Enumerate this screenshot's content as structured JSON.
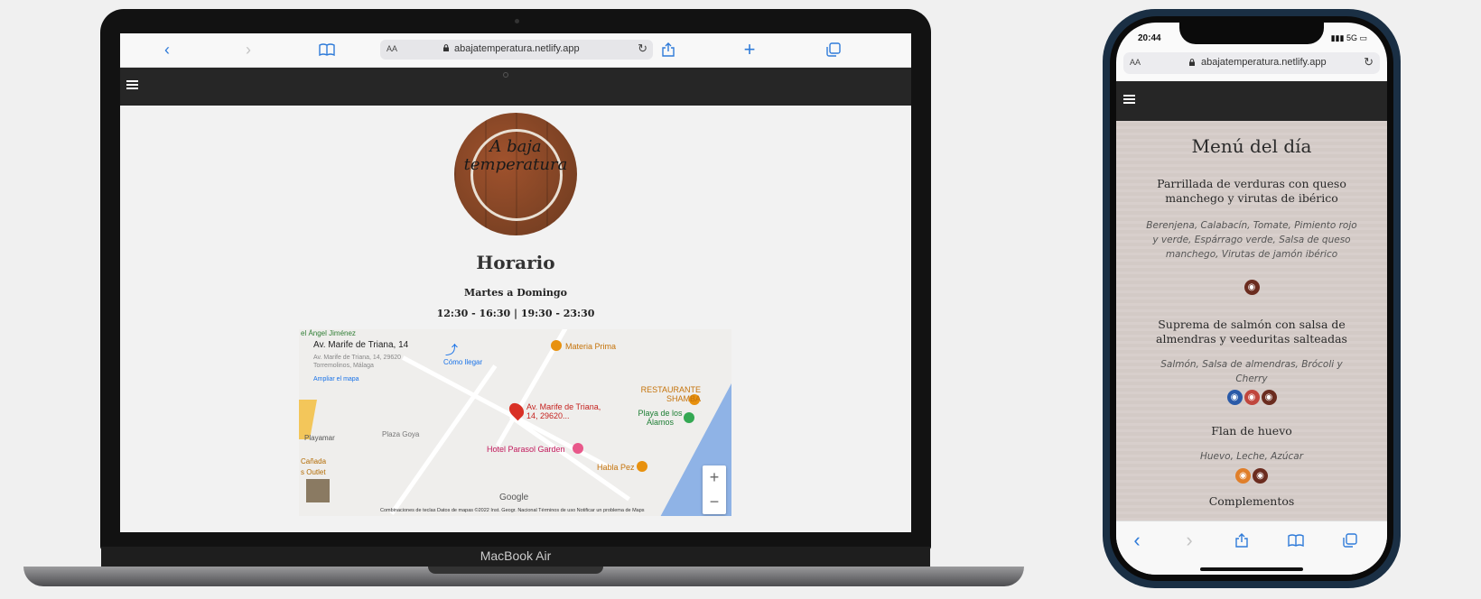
{
  "laptop": {
    "browser": {
      "aa_label": "AA",
      "url": "abajatemperatura.netlify.app",
      "icons": {
        "back": "chevron-left-icon",
        "forward": "chevron-right-icon",
        "bookmarks": "book-icon",
        "reload": "reload-icon",
        "share": "share-icon",
        "new_tab": "plus-icon",
        "tabs": "tabs-icon"
      }
    },
    "logo_text": "A baja temperatura",
    "horario": {
      "title": "Horario",
      "days": "Martes a Domingo",
      "hours": "12:30 - 16:30 | 19:30 - 23:30"
    },
    "map": {
      "card_title": "Av. Marife de Triana, 14",
      "card_address": "Av. Marife de Triana, 14, 29620 Torremolinos, Málaga",
      "card_link": "Ampliar el mapa",
      "directions": "Cómo llegar",
      "pin_label": "Av. Marife de Triana, 14, 29620...",
      "pois": {
        "materia_prima": "Materia Prima",
        "restaurante_shamba": "RESTAURANTE SHAMBA",
        "playa_alamos": "Playa de los Álamos",
        "hotel": "Hotel Parasol Garden",
        "habla_pez": "Habla Pez",
        "plaza_goya": "Plaza Goya",
        "angel_jimenez": "el Ángel Jiménez",
        "playamar": "Playamar",
        "canada": "Cañada",
        "outlet": "s Outlet"
      },
      "google": "Google",
      "footer": "Combinaciones de teclas   Datos de mapas ©2022 Inst. Geogr. Nacional   Términos de uso   Notificar un problema de Maps",
      "zoom_in": "+",
      "zoom_out": "−"
    },
    "model_label": "MacBook Air"
  },
  "phone": {
    "time": "20:44",
    "signal": "5G",
    "aa_label": "AA",
    "url": "abajatemperatura.netlify.app",
    "menu_title": "Menú del día",
    "dishes": [
      {
        "name": "Parrillada de verduras con queso manchego y virutas de ibérico",
        "description": "Berenjena, Calabacín, Tomate, Pimiento rojo y verde, Espárrago verde, Salsa de queso manchego, Virutas de jamón ibérico"
      },
      {
        "name": "Suprema de salmón con salsa de almendras y veeduritas salteadas",
        "description": "Salmón, Salsa de almendras, Brócoli y Cherry"
      },
      {
        "name": "Flan de huevo",
        "description": "Huevo, Leche, Azúcar"
      }
    ],
    "complementos": "Complementos",
    "allergen_colors": {
      "dairy": "#6b2c1f",
      "fish": "#2a5aa8",
      "nuts": "#c0463d",
      "egg": "#e07f2a"
    }
  }
}
